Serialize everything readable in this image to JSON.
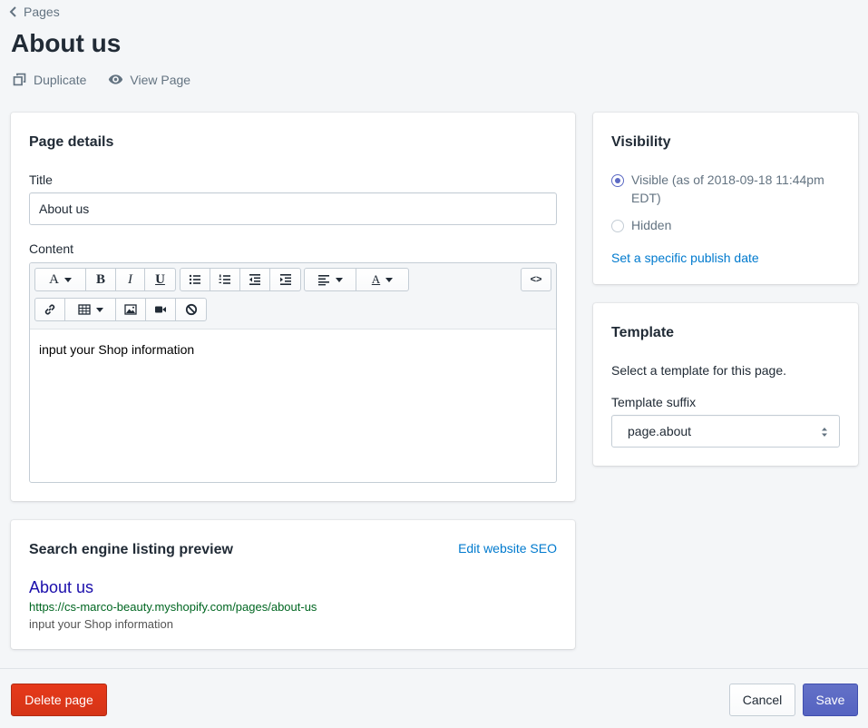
{
  "breadcrumb": {
    "label": "Pages"
  },
  "page": {
    "title": "About us"
  },
  "actions": {
    "duplicate": "Duplicate",
    "view_page": "View Page"
  },
  "page_details": {
    "heading": "Page details",
    "title_label": "Title",
    "title_value": "About us",
    "content_label": "Content",
    "content_value": "input your Shop information",
    "toolbar": {
      "font": "A",
      "bold": "B",
      "italic": "I",
      "underline": "U",
      "text_color": "A",
      "code": "<>"
    }
  },
  "visibility": {
    "heading": "Visibility",
    "visible_label": "Visible (as of 2018-09-18 11:44pm EDT)",
    "visible_checked": true,
    "hidden_label": "Hidden",
    "hidden_checked": false,
    "publish_date_link": "Set a specific publish date"
  },
  "template": {
    "heading": "Template",
    "description": "Select a template for this page.",
    "suffix_label": "Template suffix",
    "suffix_value": "page.about"
  },
  "seo": {
    "heading": "Search engine listing preview",
    "edit_link": "Edit website SEO",
    "preview_title": "About us",
    "preview_url": "https://cs-marco-beauty.myshopify.com/pages/about-us",
    "preview_description": "input your Shop information"
  },
  "footer": {
    "delete": "Delete page",
    "cancel": "Cancel",
    "save": "Save"
  },
  "colors": {
    "accent": "#5c6ac4",
    "link": "#007ace",
    "danger": "#de3618",
    "seo_title": "#1a0dab",
    "seo_url": "#006621",
    "background": "#f4f6f8"
  },
  "icons": {
    "back": "chevron-left-icon",
    "duplicate": "duplicate-icon",
    "view": "eye-icon",
    "bullet_list": "bullet-list-icon",
    "numbered_list": "numbered-list-icon",
    "outdent": "outdent-icon",
    "indent": "indent-icon",
    "align": "align-left-icon",
    "link": "link-icon",
    "table": "table-icon",
    "image": "image-icon",
    "video": "video-icon",
    "clear": "clear-format-icon",
    "select": "select-arrows-icon"
  }
}
